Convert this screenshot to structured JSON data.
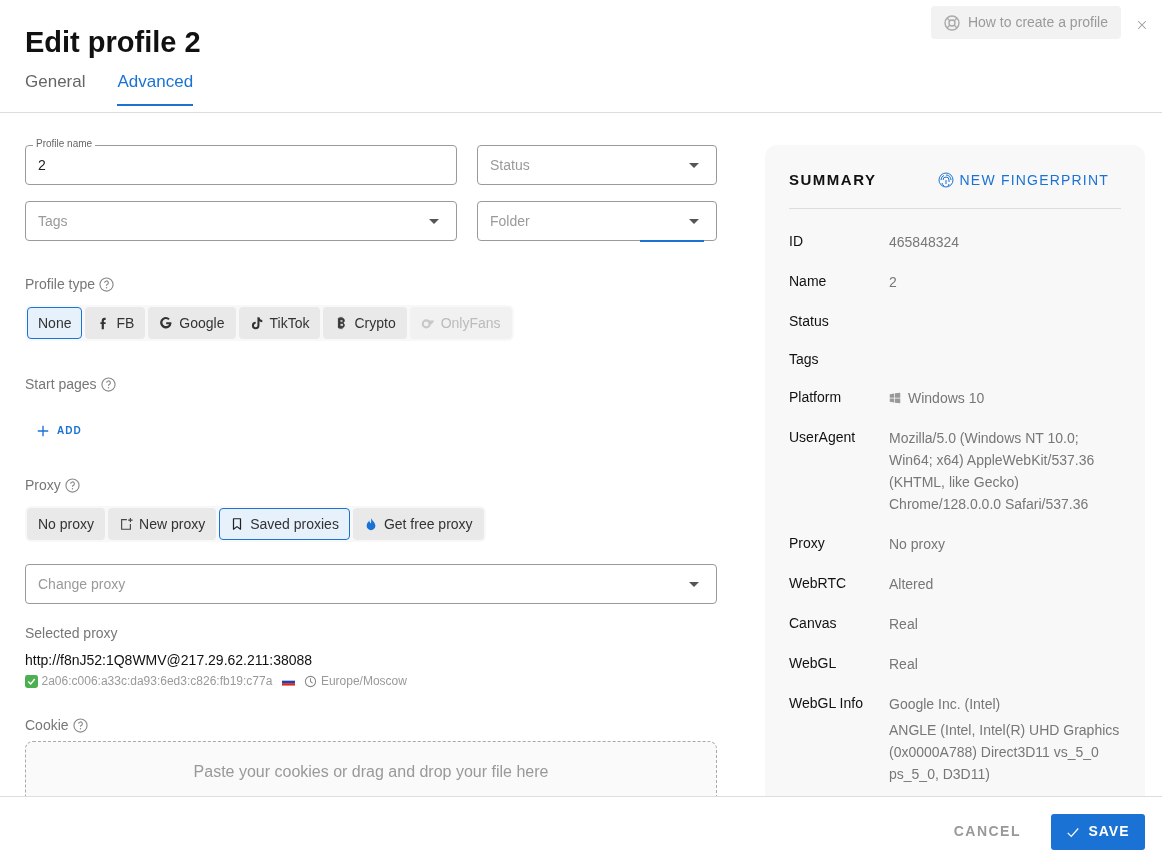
{
  "help_button": {
    "label": "How to create a profile"
  },
  "title": "Edit profile 2",
  "tabs": [
    {
      "label": "General",
      "selected": false
    },
    {
      "label": "Advanced",
      "selected": true
    }
  ],
  "fields": [
    {
      "kind": "text",
      "label": "Profile name",
      "value": "2"
    },
    {
      "kind": "select",
      "placeholder": "Status"
    },
    {
      "kind": "select",
      "placeholder": "Tags"
    },
    {
      "kind": "select",
      "placeholder": "Folder",
      "focused": true
    }
  ],
  "profile_type": {
    "label": "Profile type",
    "options": [
      {
        "kind": "none",
        "label": "None",
        "selected": true,
        "disabled": false
      },
      {
        "kind": "facebook",
        "label": "FB",
        "selected": false,
        "disabled": false
      },
      {
        "kind": "google",
        "label": "Google",
        "selected": false,
        "disabled": false
      },
      {
        "kind": "tiktok",
        "label": "TikTok",
        "selected": false,
        "disabled": false
      },
      {
        "kind": "crypto",
        "label": "Crypto",
        "selected": false,
        "disabled": false
      },
      {
        "kind": "onlyfans",
        "label": "OnlyFans",
        "selected": false,
        "disabled": true
      }
    ]
  },
  "start_pages": {
    "label": "Start pages",
    "add_button": "ADD"
  },
  "proxy": {
    "label": "Proxy",
    "options": [
      {
        "kind": "none",
        "label": "No proxy",
        "selected": false
      },
      {
        "kind": "new",
        "label": "New proxy",
        "selected": false
      },
      {
        "kind": "saved",
        "label": "Saved proxies",
        "selected": true
      },
      {
        "kind": "free",
        "label": "Get free proxy",
        "selected": false
      }
    ],
    "change_placeholder": "Change proxy",
    "selected_label": "Selected proxy",
    "selected_url": "http://f8nJ52:1Q8WMV@217.29.62.211:38088",
    "valid": true,
    "ip": "2a06:c006:a33c:da93:6ed3:c826:fb19:c77a",
    "timezone": "Europe/Moscow"
  },
  "cookie": {
    "label": "Cookie",
    "placeholder": "Paste your cookies or drag and drop your file here"
  },
  "summary": {
    "title": "SUMMARY",
    "action": "NEW FINGERPRINT",
    "rows": [
      {
        "label": "ID",
        "lines": [
          "465848324"
        ]
      },
      {
        "label": "Name",
        "lines": [
          "2"
        ]
      },
      {
        "label": "Status",
        "lines": []
      },
      {
        "label": "Tags",
        "lines": []
      },
      {
        "label": "Platform",
        "kind": "windows",
        "lines": [
          "Windows 10"
        ]
      },
      {
        "label": "UserAgent",
        "lines": [
          "Mozilla/5.0 (Windows NT 10.0; Win64; x64) AppleWebKit/537.36 (KHTML, like Gecko) Chrome/128.0.0.0 Safari/537.36"
        ]
      },
      {
        "label": "Proxy",
        "lines": [
          "No proxy"
        ]
      },
      {
        "label": "WebRTC",
        "lines": [
          "Altered"
        ]
      },
      {
        "label": "Canvas",
        "lines": [
          "Real"
        ]
      },
      {
        "label": "WebGL",
        "lines": [
          "Real"
        ]
      },
      {
        "label": "WebGL Info",
        "lines": [
          "Google Inc. (Intel)",
          "ANGLE (Intel, Intel(R) UHD Graphics (0x0000A788) Direct3D11 vs_5_0 ps_5_0, D3D11)"
        ]
      }
    ]
  },
  "footer": {
    "cancel": "CANCEL",
    "save": "SAVE"
  }
}
